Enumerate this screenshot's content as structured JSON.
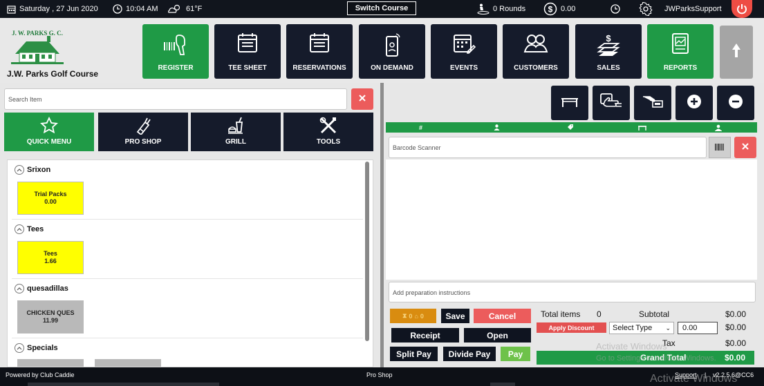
{
  "topbar": {
    "date": "Saturday , 27 Jun 2020",
    "time": "10:04 AM",
    "weather": "61°F",
    "switch_course": "Switch Course",
    "rounds": "0 Rounds",
    "balance": "0.00",
    "user": "JWParksSupport"
  },
  "header": {
    "logo_text": "J. W. PARKS G. C.",
    "course_name": "J.W. Parks Golf Course",
    "nav": [
      {
        "label": "REGISTER",
        "icon": "barcode-scanner-icon"
      },
      {
        "label": "TEE SHEET",
        "icon": "calendar-list-icon"
      },
      {
        "label": "RESERVATIONS",
        "icon": "calendar-list-icon"
      },
      {
        "label": "ON DEMAND",
        "icon": "phone-icon"
      },
      {
        "label": "EVENTS",
        "icon": "event-calendar-icon"
      },
      {
        "label": "CUSTOMERS",
        "icon": "users-icon"
      },
      {
        "label": "SALES",
        "icon": "sales-cash-icon"
      },
      {
        "label": "REPORTS",
        "icon": "report-icon"
      }
    ]
  },
  "left": {
    "search_placeholder": "Search Item",
    "categories": [
      {
        "label": "QUICK MENU",
        "icon": "star-icon"
      },
      {
        "label": "PRO SHOP",
        "icon": "golf-bag-icon"
      },
      {
        "label": "GRILL",
        "icon": "drink-food-icon"
      },
      {
        "label": "TOOLS",
        "icon": "tools-icon"
      }
    ],
    "sections": [
      {
        "name": "Srixon",
        "items": [
          {
            "name": "Trial Packs",
            "price": "0.00"
          }
        ]
      },
      {
        "name": "Tees",
        "items": [
          {
            "name": "Tees",
            "price": "1.66"
          }
        ]
      },
      {
        "name": "quesadillas",
        "items": [
          {
            "name": "CHICKEN QUES",
            "price": "11.99"
          }
        ]
      },
      {
        "name": "Specials",
        "items": []
      }
    ]
  },
  "right": {
    "columns": [
      "#"
    ],
    "barcode_placeholder": "Barcode Scanner",
    "prep_placeholder": "Add preparation instructions",
    "counter": "0",
    "counter2": "0",
    "buttons": {
      "save": "Save",
      "cancel": "Cancel",
      "receipt": "Receipt",
      "open": "Open",
      "split_pay": "Split Pay",
      "divide_pay": "Divide Pay",
      "pay": "Pay"
    },
    "totals": {
      "total_items_label": "Total items",
      "total_items": "0",
      "subtotal_label": "Subtotal",
      "subtotal": "$0.00",
      "apply_discount": "Apply Discount",
      "select_type": "Select Type",
      "discount_value": "0.00",
      "discount_amount": "$0.00",
      "tax_label": "Tax",
      "tax": "$0.00",
      "grand_total_label": "Grand Total",
      "grand_total": "$0.00"
    }
  },
  "footer": {
    "powered_by": "Powered by Club Caddie",
    "center": "Pro Shop",
    "support": "Support",
    "separator": "|",
    "version": "v2.2.5.6@CC6"
  },
  "watermark": {
    "line1": "Activate Windows",
    "line2": "Go to Settings to activate Windows."
  }
}
